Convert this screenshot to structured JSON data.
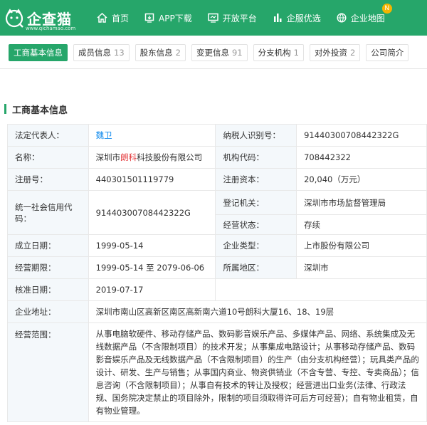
{
  "header": {
    "brand": "企查猫",
    "brand_sub": "www.qichamao.com",
    "nav": [
      {
        "label": "首页",
        "icon": "home-icon"
      },
      {
        "label": "APP下载",
        "icon": "download-icon"
      },
      {
        "label": "开放平台",
        "icon": "monitor-icon"
      },
      {
        "label": "企服优选",
        "icon": "chart-icon"
      },
      {
        "label": "企业地图",
        "icon": "globe-icon",
        "badge": "N"
      }
    ]
  },
  "tabs": [
    {
      "label": "工商基本信息",
      "count": ""
    },
    {
      "label": "成员信息",
      "count": "13"
    },
    {
      "label": "股东信息",
      "count": "2"
    },
    {
      "label": "变更信息",
      "count": "91"
    },
    {
      "label": "分支机构",
      "count": "1"
    },
    {
      "label": "对外投资",
      "count": "2"
    },
    {
      "label": "公司简介",
      "count": ""
    }
  ],
  "section": {
    "title": "工商基本信息"
  },
  "info": {
    "legal_rep_label": "法定代表人：",
    "legal_rep": "魏卫",
    "taxpayer_id_label": "纳税人识别号：",
    "taxpayer_id": "91440300708442322G",
    "name_label": "名称：",
    "name_pre": "深圳市",
    "name_hl": "朗科",
    "name_post": "科技股份有限公司",
    "org_code_label": "机构代码：",
    "org_code": "708442322",
    "reg_no_label": "注册号：",
    "reg_no": "440301501119779",
    "reg_capital_label": "注册资本：",
    "reg_capital": "20,040（万元）",
    "uscc_label": "统一社会信用代码：",
    "uscc": "91440300708442322G",
    "reg_authority_label": "登记机关：",
    "reg_authority": "深圳市市场监督管理局",
    "status_label": "经营状态：",
    "status": "存续",
    "founded_label": "成立日期：",
    "founded": "1999-05-14",
    "company_type_label": "企业类型：",
    "company_type": "上市股份有限公司",
    "term_label": "经营期限：",
    "term": "1999-05-14 至 2079-06-06",
    "region_label": "所属地区：",
    "region": "深圳市",
    "approval_label": "核准日期：",
    "approval": "2019-07-17",
    "address_label": "企业地址：",
    "address": "深圳市南山区高新区南区高新南六道10号朗科大厦16、18、19层",
    "scope_label": "经营范围：",
    "scope": "从事电脑软硬件、移动存储产品、数码影音娱乐产品、多媒体产品、网络、系统集成及无线数据产品（不含限制项目）的技术开发；从事集成电路设计；从事移动存储产品、数码影音娱乐产品及无线数据产品（不含限制项目）的生产（由分支机构经营）；玩具类产品的设计、研发、生产与销售；从事国内商业、物资供销业（不含专营、专控、专卖商品）；信息咨询（不含限制项目）；从事自有技术的转让及授权；经营进出口业务(法律、行政法规、国务院决定禁止的项目除外，限制的项目须取得许可后方可经营)；自有物业租赁，自有物业管理。"
  }
}
